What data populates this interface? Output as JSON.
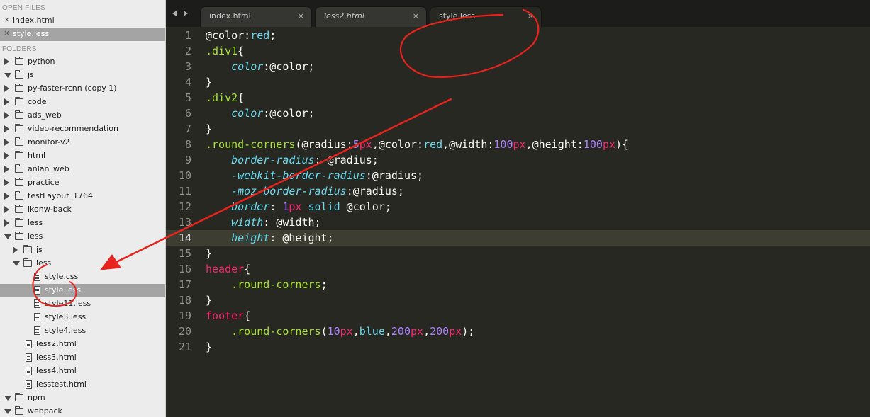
{
  "sidebar": {
    "open_files_heading": "OPEN FILES",
    "open_files": [
      {
        "label": "index.html",
        "selected": false
      },
      {
        "label": "style.less",
        "selected": true
      }
    ],
    "folders_heading": "FOLDERS",
    "tree": [
      {
        "label": "python",
        "depth": 0,
        "kind": "folder",
        "state": "closed"
      },
      {
        "label": "js",
        "depth": 0,
        "kind": "folder",
        "state": "open"
      },
      {
        "label": "py-faster-rcnn (copy 1)",
        "depth": 0,
        "kind": "folder",
        "state": "closed"
      },
      {
        "label": "code",
        "depth": 0,
        "kind": "folder",
        "state": "closed"
      },
      {
        "label": "ads_web",
        "depth": 0,
        "kind": "folder",
        "state": "closed"
      },
      {
        "label": "video-recommendation",
        "depth": 0,
        "kind": "folder",
        "state": "closed"
      },
      {
        "label": "monitor-v2",
        "depth": 0,
        "kind": "folder",
        "state": "closed"
      },
      {
        "label": "html",
        "depth": 0,
        "kind": "folder",
        "state": "closed"
      },
      {
        "label": "anlan_web",
        "depth": 0,
        "kind": "folder",
        "state": "closed"
      },
      {
        "label": "practice",
        "depth": 0,
        "kind": "folder",
        "state": "closed"
      },
      {
        "label": "testLayout_1764",
        "depth": 0,
        "kind": "folder",
        "state": "closed"
      },
      {
        "label": "ikonw-back",
        "depth": 0,
        "kind": "folder",
        "state": "closed"
      },
      {
        "label": "less",
        "depth": 0,
        "kind": "folder",
        "state": "closed"
      },
      {
        "label": "less",
        "depth": 0,
        "kind": "folder",
        "state": "open"
      },
      {
        "label": "js",
        "depth": 1,
        "kind": "folder",
        "state": "closed"
      },
      {
        "label": "less",
        "depth": 1,
        "kind": "folder",
        "state": "open"
      },
      {
        "label": "style.css",
        "depth": 2,
        "kind": "file",
        "selected": false
      },
      {
        "label": "style.less",
        "depth": 2,
        "kind": "file",
        "selected": true
      },
      {
        "label": "style11.less",
        "depth": 2,
        "kind": "file",
        "selected": false
      },
      {
        "label": "style3.less",
        "depth": 2,
        "kind": "file",
        "selected": false
      },
      {
        "label": "style4.less",
        "depth": 2,
        "kind": "file",
        "selected": false
      },
      {
        "label": "less2.html",
        "depth": 1,
        "kind": "file",
        "selected": false
      },
      {
        "label": "less3.html",
        "depth": 1,
        "kind": "file",
        "selected": false
      },
      {
        "label": "less4.html",
        "depth": 1,
        "kind": "file",
        "selected": false
      },
      {
        "label": "lesstest.html",
        "depth": 1,
        "kind": "file",
        "selected": false
      },
      {
        "label": "npm",
        "depth": 0,
        "kind": "folder",
        "state": "open"
      },
      {
        "label": "webpack",
        "depth": 0,
        "kind": "folder",
        "state": "open"
      }
    ]
  },
  "tabs": [
    {
      "label": "index.html",
      "italic": false,
      "active": false,
      "close": "×"
    },
    {
      "label": "less2.html",
      "italic": true,
      "active": false,
      "close": "×"
    },
    {
      "label": "style.less",
      "italic": false,
      "active": true,
      "close": "×"
    }
  ],
  "editor": {
    "current_line": 14,
    "lines": [
      [
        [
          "@color:",
          "w"
        ],
        [
          "red",
          "b"
        ],
        [
          ";",
          "w"
        ]
      ],
      [
        [
          ".div1",
          "a"
        ],
        [
          "{",
          "w"
        ]
      ],
      [
        [
          "    ",
          "w"
        ],
        [
          "color",
          "bi"
        ],
        [
          ":@color;",
          "w"
        ]
      ],
      [
        [
          "}",
          "w"
        ]
      ],
      [
        [
          ".div2",
          "a"
        ],
        [
          "{",
          "w"
        ]
      ],
      [
        [
          "    ",
          "w"
        ],
        [
          "color",
          "bi"
        ],
        [
          ":@color;",
          "w"
        ]
      ],
      [
        [
          "}",
          "w"
        ]
      ],
      [
        [
          ".round-corners",
          "a"
        ],
        [
          "(@radius:",
          "w"
        ],
        [
          "5",
          "p"
        ],
        [
          "px",
          "r"
        ],
        [
          ",@color:",
          "w"
        ],
        [
          "red",
          "b"
        ],
        [
          ",@width:",
          "w"
        ],
        [
          "100",
          "p"
        ],
        [
          "px",
          "r"
        ],
        [
          ",@height:",
          "w"
        ],
        [
          "100",
          "p"
        ],
        [
          "px",
          "r"
        ],
        [
          "){",
          "w"
        ]
      ],
      [
        [
          "    ",
          "w"
        ],
        [
          "border-radius",
          "bi"
        ],
        [
          ": @radius;",
          "w"
        ]
      ],
      [
        [
          "    ",
          "w"
        ],
        [
          "-webkit-border-radius",
          "bi"
        ],
        [
          ":@radius;",
          "w"
        ]
      ],
      [
        [
          "    ",
          "w"
        ],
        [
          "-moz-border-radius",
          "bi"
        ],
        [
          ":@radius;",
          "w"
        ]
      ],
      [
        [
          "    ",
          "w"
        ],
        [
          "border",
          "bi"
        ],
        [
          ": ",
          "w"
        ],
        [
          "1",
          "p"
        ],
        [
          "px",
          "r"
        ],
        [
          " ",
          "w"
        ],
        [
          "solid",
          "b"
        ],
        [
          " @color;",
          "w"
        ]
      ],
      [
        [
          "    ",
          "w"
        ],
        [
          "width",
          "bi"
        ],
        [
          ": @width;",
          "w"
        ]
      ],
      [
        [
          "    ",
          "w"
        ],
        [
          "height",
          "bi"
        ],
        [
          ": @height;",
          "w"
        ]
      ],
      [
        [
          "}",
          "w"
        ]
      ],
      [
        [
          "header",
          "r"
        ],
        [
          "{",
          "w"
        ]
      ],
      [
        [
          "    ",
          "w"
        ],
        [
          ".round-corners",
          "a"
        ],
        [
          ";",
          "w"
        ]
      ],
      [
        [
          "}",
          "w"
        ]
      ],
      [
        [
          "footer",
          "r"
        ],
        [
          "{",
          "w"
        ]
      ],
      [
        [
          "    ",
          "w"
        ],
        [
          ".round-corners",
          "a"
        ],
        [
          "(",
          "w"
        ],
        [
          "10",
          "p"
        ],
        [
          "px",
          "r"
        ],
        [
          ",",
          "w"
        ],
        [
          "blue",
          "b"
        ],
        [
          ",",
          "w"
        ],
        [
          "200",
          "p"
        ],
        [
          "px",
          "r"
        ],
        [
          ",",
          "w"
        ],
        [
          "200",
          "p"
        ],
        [
          "px",
          "r"
        ],
        [
          ");",
          "w"
        ]
      ],
      [
        [
          "}",
          "w"
        ]
      ]
    ]
  },
  "colors": {
    "annotation": "#e8231e",
    "editor_bg": "#272822",
    "sidebar_bg": "#ececec"
  }
}
